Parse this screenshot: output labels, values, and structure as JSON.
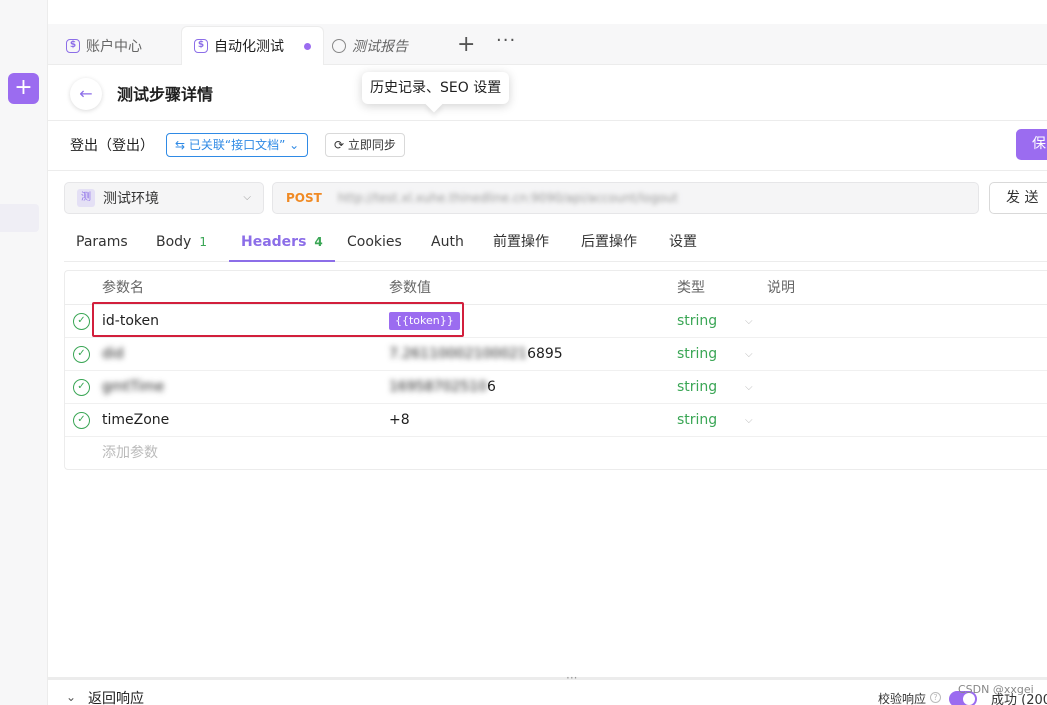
{
  "tabs": [
    {
      "label": "账户中心"
    },
    {
      "label": "自动化测试"
    },
    {
      "label": "测试报告"
    }
  ],
  "tooltip": "历史记录、SEO 设置",
  "page_title": "测试步骤详情",
  "step": {
    "name": "登出（登出）",
    "linked_label": "已关联“接口文档”",
    "sync_label": "立即同步",
    "save_label": "保"
  },
  "request": {
    "env_badge": "测",
    "env_label": "测试环境",
    "method": "POST",
    "url": "http://test.xl.xuhe.thinedline.cn:9090/api/account/logout",
    "send_label": "发 送"
  },
  "request_tabs": [
    {
      "label": "Params",
      "count": ""
    },
    {
      "label": "Body",
      "count": "1"
    },
    {
      "label": "Headers",
      "count": "4"
    },
    {
      "label": "Cookies",
      "count": ""
    },
    {
      "label": "Auth",
      "count": ""
    },
    {
      "label": "前置操作",
      "count": ""
    },
    {
      "label": "后置操作",
      "count": ""
    },
    {
      "label": "设置",
      "count": ""
    }
  ],
  "params_table": {
    "columns": [
      "参数名",
      "参数值",
      "类型",
      "说明"
    ],
    "rows": [
      {
        "name": "id-token",
        "value": "{{token}}",
        "type": "string"
      },
      {
        "name": "did",
        "value": "7.26110002100021",
        "value_suffix": "6895",
        "type": "string"
      },
      {
        "name": "gmtTime",
        "value": "16958702510",
        "value_suffix": "6",
        "type": "string"
      },
      {
        "name": "timeZone",
        "value": "+8",
        "type": "string"
      }
    ],
    "add_placeholder": "添加参数"
  },
  "response": {
    "label": "返回响应",
    "verify_label": "校验响应",
    "status": "成功 (200"
  },
  "watermark": "CSDN @xxgei",
  "colors": {
    "accent": "#9b6cf0",
    "link": "#2f8ae5",
    "method_post": "#f08a24",
    "type_green": "#3aa655",
    "highlight_red": "#d21f3c"
  }
}
